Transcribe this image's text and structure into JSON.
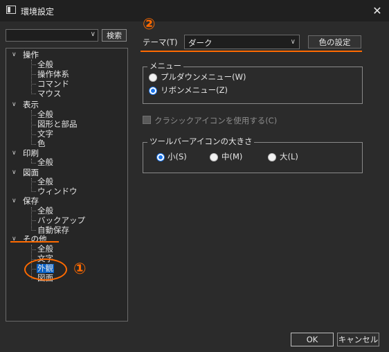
{
  "window": {
    "title": "環境設定",
    "icon": "window-icon",
    "close_icon": "✕"
  },
  "search": {
    "value": "",
    "dropdown_icon": "chevron-down-icon",
    "button_label": "検索"
  },
  "tree": {
    "groups": [
      {
        "label": "操作",
        "children": [
          "全般",
          "操作体系",
          "コマンド",
          "マウス"
        ]
      },
      {
        "label": "表示",
        "children": [
          "全般",
          "図形と部品",
          "文字",
          "色"
        ]
      },
      {
        "label": "印刷",
        "children": [
          "全般"
        ]
      },
      {
        "label": "図面",
        "children": [
          "全般",
          "ウィンドウ"
        ]
      },
      {
        "label": "保存",
        "children": [
          "全般",
          "バックアップ",
          "自動保存"
        ]
      },
      {
        "label": "その他",
        "children": [
          "全般",
          "文字",
          "外観",
          "図面"
        ]
      }
    ],
    "selected": "外観"
  },
  "annotations": {
    "marker1": "①",
    "marker2": "②",
    "color": "#ff6a00"
  },
  "theme": {
    "label": "テーマ(T)",
    "value": "ダーク",
    "color_button": "色の設定"
  },
  "menu_group": {
    "label": "メニュー",
    "options": [
      {
        "label": "プルダウンメニュー(W)",
        "selected": false
      },
      {
        "label": "リボンメニュー(Z)",
        "selected": true
      }
    ]
  },
  "classic_icon": {
    "label": "クラシックアイコンを使用する(C)",
    "checked": false,
    "enabled": false
  },
  "toolbar_group": {
    "label": "ツールバーアイコンの大きさ",
    "options": [
      {
        "label": "小(S)",
        "selected": true
      },
      {
        "label": "中(M)",
        "selected": false
      },
      {
        "label": "大(L)",
        "selected": false
      }
    ]
  },
  "buttons": {
    "ok": "OK",
    "cancel": "キャンセル"
  },
  "colors": {
    "background": "#2b2b2b",
    "selection": "#0a63c9",
    "radio_accent": "#1a73e8"
  }
}
